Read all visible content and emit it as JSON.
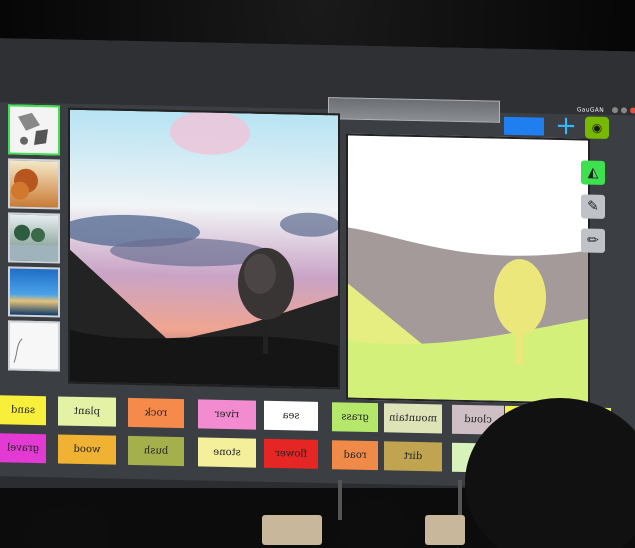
{
  "app": {
    "title": "GauGAN",
    "colors": {
      "window_bg": "#3b3e42",
      "accent_blue": "#1f7ef0",
      "plus_color": "#33b7ff",
      "nvidia_green": "#76b900",
      "tool_green": "#3fe04f",
      "selected_thumb_border": "#3fe04f"
    }
  },
  "toolbar": {
    "plus_glyph": "+",
    "eye_glyph": "◉"
  },
  "tools": [
    {
      "name": "fill-tool",
      "glyph": "◭",
      "color": "#3fe04f"
    },
    {
      "name": "brush-tool",
      "glyph": "✎",
      "color": "#bfc2c6"
    },
    {
      "name": "pencil-tool",
      "glyph": "✏",
      "color": "#bfc2c6"
    }
  ],
  "labels_row1": [
    {
      "text": "sand",
      "color": "#f7ef3a"
    },
    {
      "text": "plant",
      "color": "#e4f2a6"
    },
    {
      "text": "rock",
      "color": "#f58a4b"
    },
    {
      "text": "river",
      "color": "#f28bcf"
    },
    {
      "text": "sea",
      "color": "#ffffff"
    },
    {
      "text": "grass",
      "color": "#b5e86a"
    },
    {
      "text": "mountain",
      "color": "#dfe4b8"
    },
    {
      "text": "cloud",
      "color": "#cdbfc4"
    },
    {
      "text": "",
      "color": "#f2f04c"
    }
  ],
  "labels_row2": [
    {
      "text": "gravel",
      "color": "#e23ad2"
    },
    {
      "text": "wood",
      "color": "#f0b233"
    },
    {
      "text": "bush",
      "color": "#a4b04b"
    },
    {
      "text": "stone",
      "color": "#f3ef9a"
    },
    {
      "text": "flower",
      "color": "#e62525"
    },
    {
      "text": "road",
      "color": "#f08a48"
    },
    {
      "text": "dirt",
      "color": "#c0a44f"
    },
    {
      "text": "hill",
      "color": "#d7f2bb"
    }
  ]
}
